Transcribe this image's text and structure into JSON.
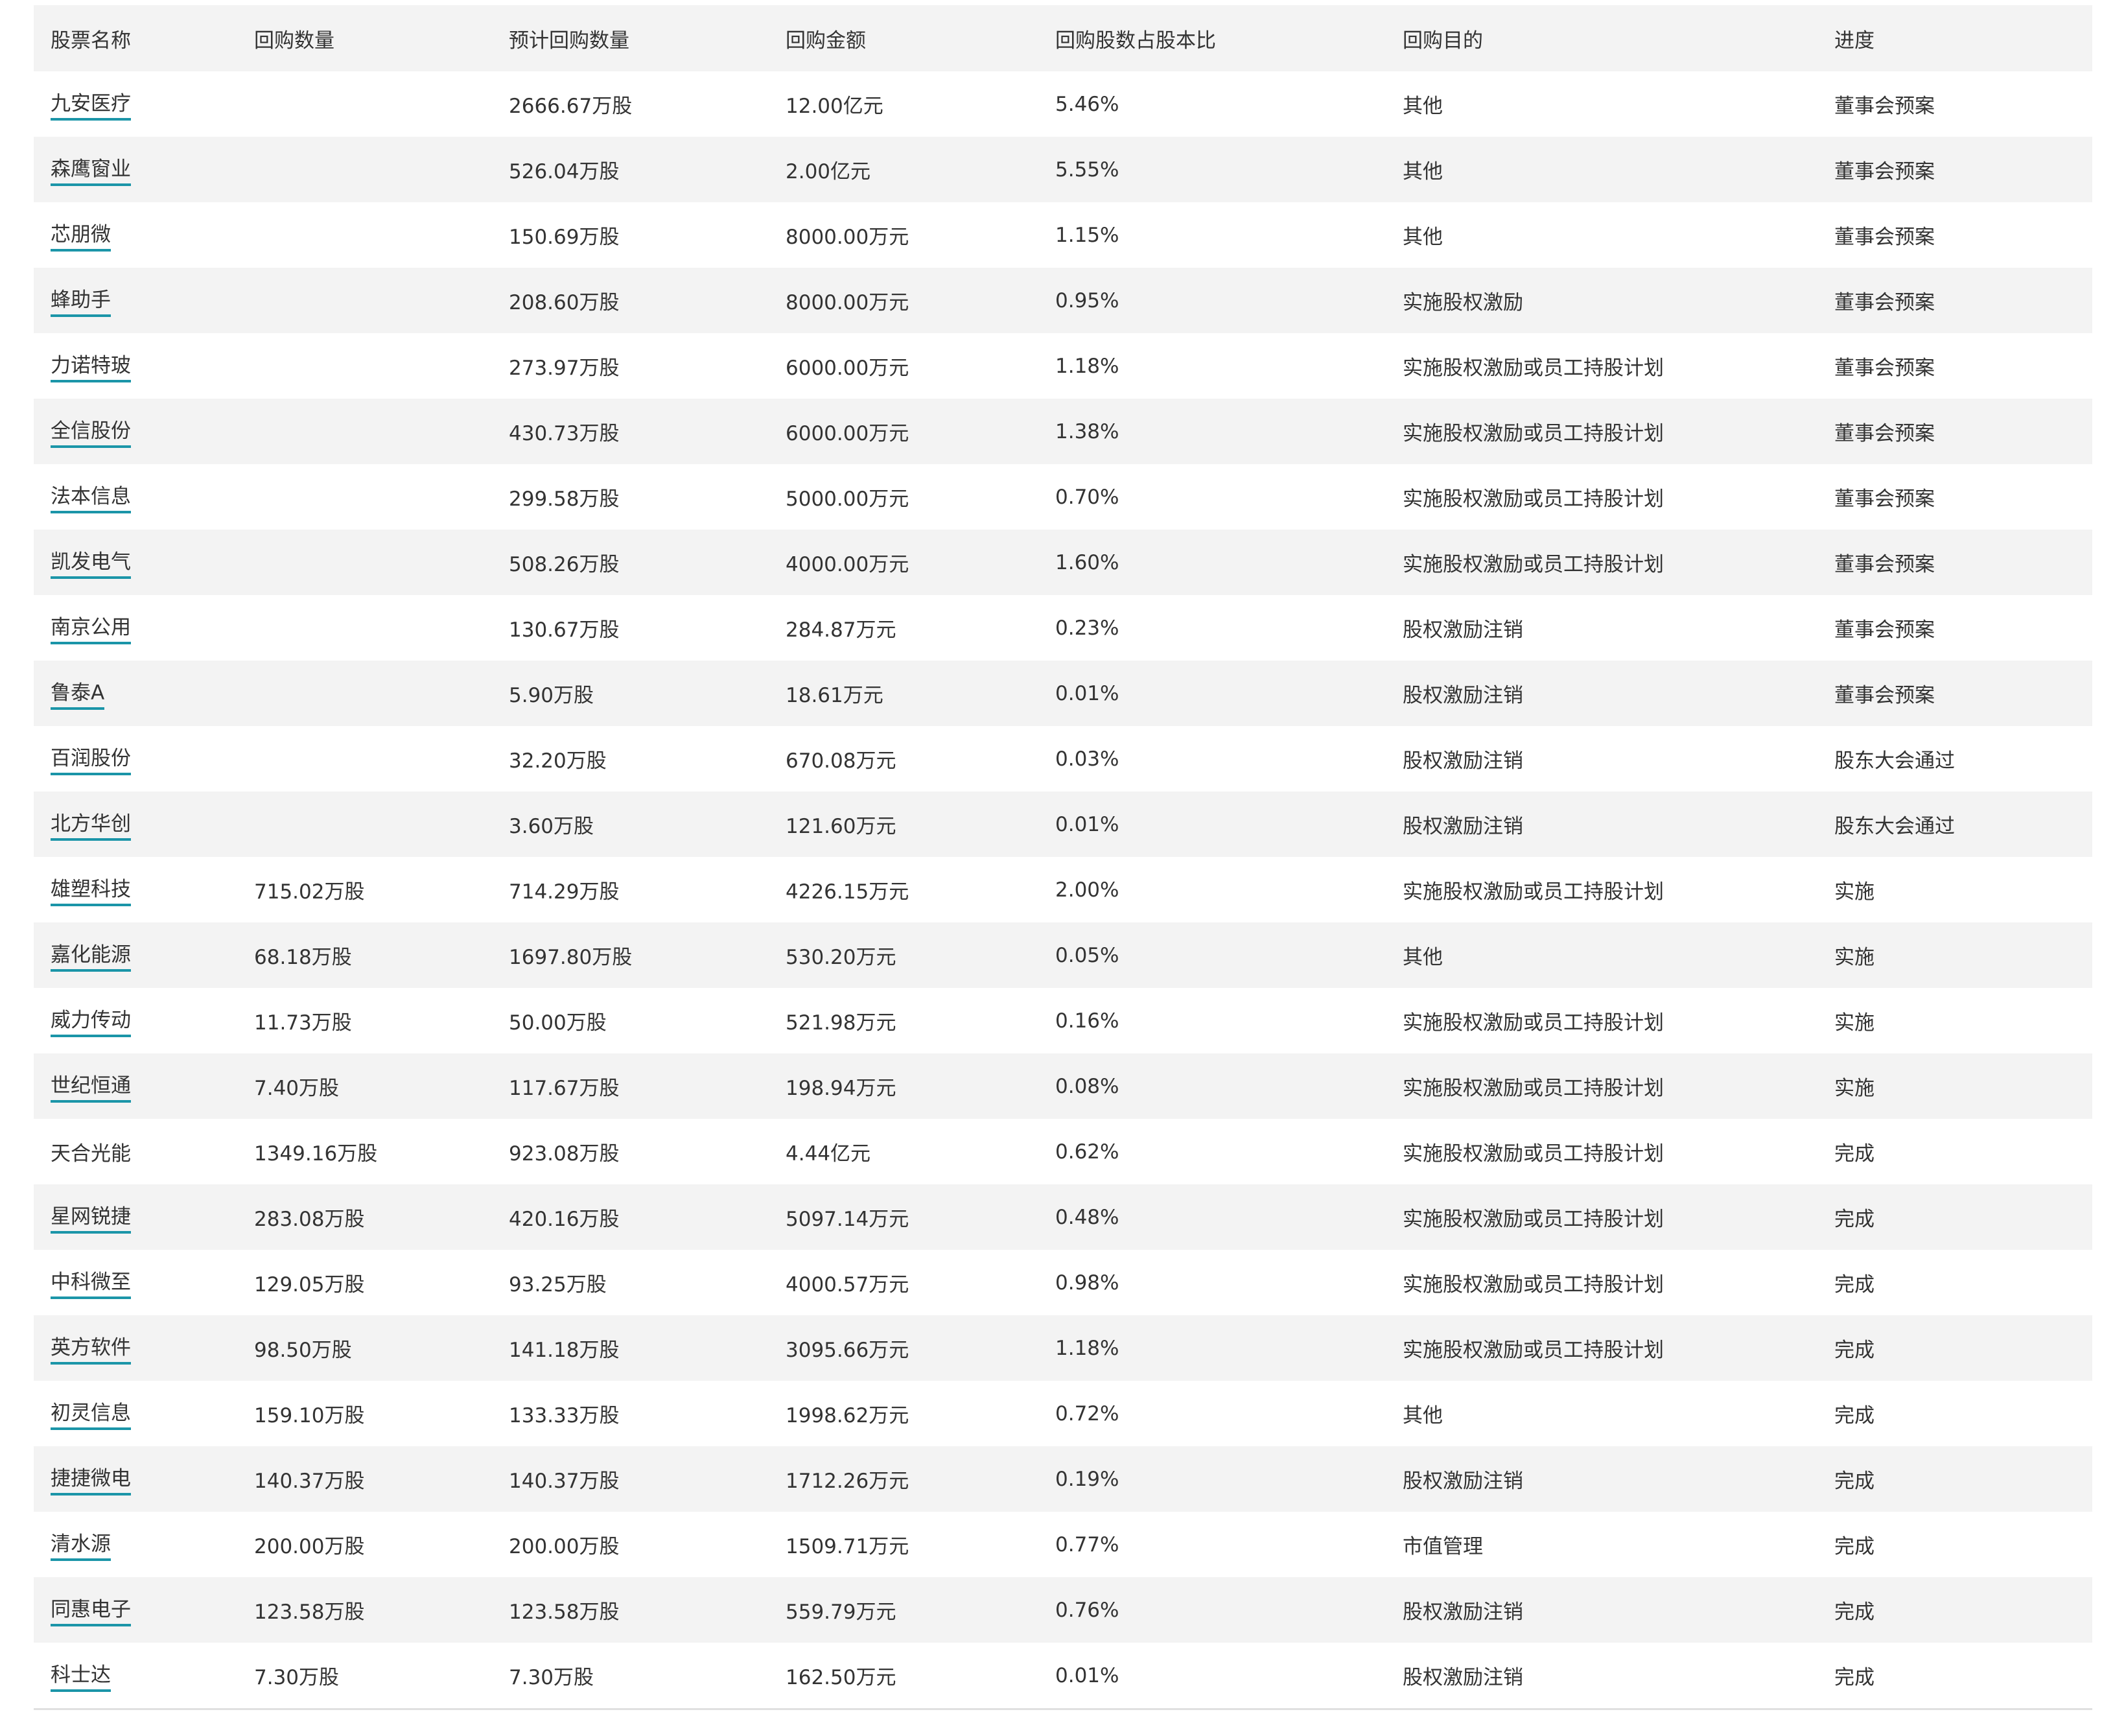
{
  "table": {
    "columns": [
      "股票名称",
      "回购数量",
      "预计回购数量",
      "回购金额",
      "回购股数占股本比",
      "回购目的",
      "进度"
    ],
    "rows": [
      {
        "name": "九安医疗",
        "linked": true,
        "repurchased": "",
        "planned": "2666.67万股",
        "amount": "12.00亿元",
        "ratio": "5.46%",
        "purpose": "其他",
        "progress": "董事会预案"
      },
      {
        "name": "森鹰窗业",
        "linked": true,
        "repurchased": "",
        "planned": "526.04万股",
        "amount": "2.00亿元",
        "ratio": "5.55%",
        "purpose": "其他",
        "progress": "董事会预案"
      },
      {
        "name": "芯朋微",
        "linked": true,
        "repurchased": "",
        "planned": "150.69万股",
        "amount": "8000.00万元",
        "ratio": "1.15%",
        "purpose": "其他",
        "progress": "董事会预案"
      },
      {
        "name": "蜂助手",
        "linked": true,
        "repurchased": "",
        "planned": "208.60万股",
        "amount": "8000.00万元",
        "ratio": "0.95%",
        "purpose": "实施股权激励",
        "progress": "董事会预案"
      },
      {
        "name": "力诺特玻",
        "linked": true,
        "repurchased": "",
        "planned": "273.97万股",
        "amount": "6000.00万元",
        "ratio": "1.18%",
        "purpose": "实施股权激励或员工持股计划",
        "progress": "董事会预案"
      },
      {
        "name": "全信股份",
        "linked": true,
        "repurchased": "",
        "planned": "430.73万股",
        "amount": "6000.00万元",
        "ratio": "1.38%",
        "purpose": "实施股权激励或员工持股计划",
        "progress": "董事会预案"
      },
      {
        "name": "法本信息",
        "linked": true,
        "repurchased": "",
        "planned": "299.58万股",
        "amount": "5000.00万元",
        "ratio": "0.70%",
        "purpose": "实施股权激励或员工持股计划",
        "progress": "董事会预案"
      },
      {
        "name": "凯发电气",
        "linked": true,
        "repurchased": "",
        "planned": "508.26万股",
        "amount": "4000.00万元",
        "ratio": "1.60%",
        "purpose": "实施股权激励或员工持股计划",
        "progress": "董事会预案"
      },
      {
        "name": "南京公用",
        "linked": true,
        "repurchased": "",
        "planned": "130.67万股",
        "amount": "284.87万元",
        "ratio": "0.23%",
        "purpose": "股权激励注销",
        "progress": "董事会预案"
      },
      {
        "name": "鲁泰A",
        "linked": true,
        "repurchased": "",
        "planned": "5.90万股",
        "amount": "18.61万元",
        "ratio": "0.01%",
        "purpose": "股权激励注销",
        "progress": "董事会预案"
      },
      {
        "name": "百润股份",
        "linked": true,
        "repurchased": "",
        "planned": "32.20万股",
        "amount": "670.08万元",
        "ratio": "0.03%",
        "purpose": "股权激励注销",
        "progress": "股东大会通过"
      },
      {
        "name": "北方华创",
        "linked": true,
        "repurchased": "",
        "planned": "3.60万股",
        "amount": "121.60万元",
        "ratio": "0.01%",
        "purpose": "股权激励注销",
        "progress": "股东大会通过"
      },
      {
        "name": "雄塑科技",
        "linked": true,
        "repurchased": "715.02万股",
        "planned": "714.29万股",
        "amount": "4226.15万元",
        "ratio": "2.00%",
        "purpose": "实施股权激励或员工持股计划",
        "progress": "实施"
      },
      {
        "name": "嘉化能源",
        "linked": true,
        "repurchased": "68.18万股",
        "planned": "1697.80万股",
        "amount": "530.20万元",
        "ratio": "0.05%",
        "purpose": "其他",
        "progress": "实施"
      },
      {
        "name": "威力传动",
        "linked": true,
        "repurchased": "11.73万股",
        "planned": "50.00万股",
        "amount": "521.98万元",
        "ratio": "0.16%",
        "purpose": "实施股权激励或员工持股计划",
        "progress": "实施"
      },
      {
        "name": "世纪恒通",
        "linked": true,
        "repurchased": "7.40万股",
        "planned": "117.67万股",
        "amount": "198.94万元",
        "ratio": "0.08%",
        "purpose": "实施股权激励或员工持股计划",
        "progress": "实施"
      },
      {
        "name": "天合光能",
        "linked": false,
        "repurchased": "1349.16万股",
        "planned": "923.08万股",
        "amount": "4.44亿元",
        "ratio": "0.62%",
        "purpose": "实施股权激励或员工持股计划",
        "progress": "完成"
      },
      {
        "name": "星网锐捷",
        "linked": true,
        "repurchased": "283.08万股",
        "planned": "420.16万股",
        "amount": "5097.14万元",
        "ratio": "0.48%",
        "purpose": "实施股权激励或员工持股计划",
        "progress": "完成"
      },
      {
        "name": "中科微至",
        "linked": true,
        "repurchased": "129.05万股",
        "planned": "93.25万股",
        "amount": "4000.57万元",
        "ratio": "0.98%",
        "purpose": "实施股权激励或员工持股计划",
        "progress": "完成"
      },
      {
        "name": "英方软件",
        "linked": true,
        "repurchased": "98.50万股",
        "planned": "141.18万股",
        "amount": "3095.66万元",
        "ratio": "1.18%",
        "purpose": "实施股权激励或员工持股计划",
        "progress": "完成"
      },
      {
        "name": "初灵信息",
        "linked": true,
        "repurchased": "159.10万股",
        "planned": "133.33万股",
        "amount": "1998.62万元",
        "ratio": "0.72%",
        "purpose": "其他",
        "progress": "完成"
      },
      {
        "name": "捷捷微电",
        "linked": true,
        "repurchased": "140.37万股",
        "planned": "140.37万股",
        "amount": "1712.26万元",
        "ratio": "0.19%",
        "purpose": "股权激励注销",
        "progress": "完成"
      },
      {
        "name": "清水源",
        "linked": true,
        "repurchased": "200.00万股",
        "planned": "200.00万股",
        "amount": "1509.71万元",
        "ratio": "0.77%",
        "purpose": "市值管理",
        "progress": "完成"
      },
      {
        "name": "同惠电子",
        "linked": true,
        "repurchased": "123.58万股",
        "planned": "123.58万股",
        "amount": "559.79万元",
        "ratio": "0.76%",
        "purpose": "股权激励注销",
        "progress": "完成"
      },
      {
        "name": "科士达",
        "linked": true,
        "repurchased": "7.30万股",
        "planned": "7.30万股",
        "amount": "162.50万元",
        "ratio": "0.01%",
        "purpose": "股权激励注销",
        "progress": "完成"
      }
    ]
  },
  "colors": {
    "link_underline": "#1b95a8",
    "text": "#333333",
    "stripe": "#f3f3f3"
  }
}
